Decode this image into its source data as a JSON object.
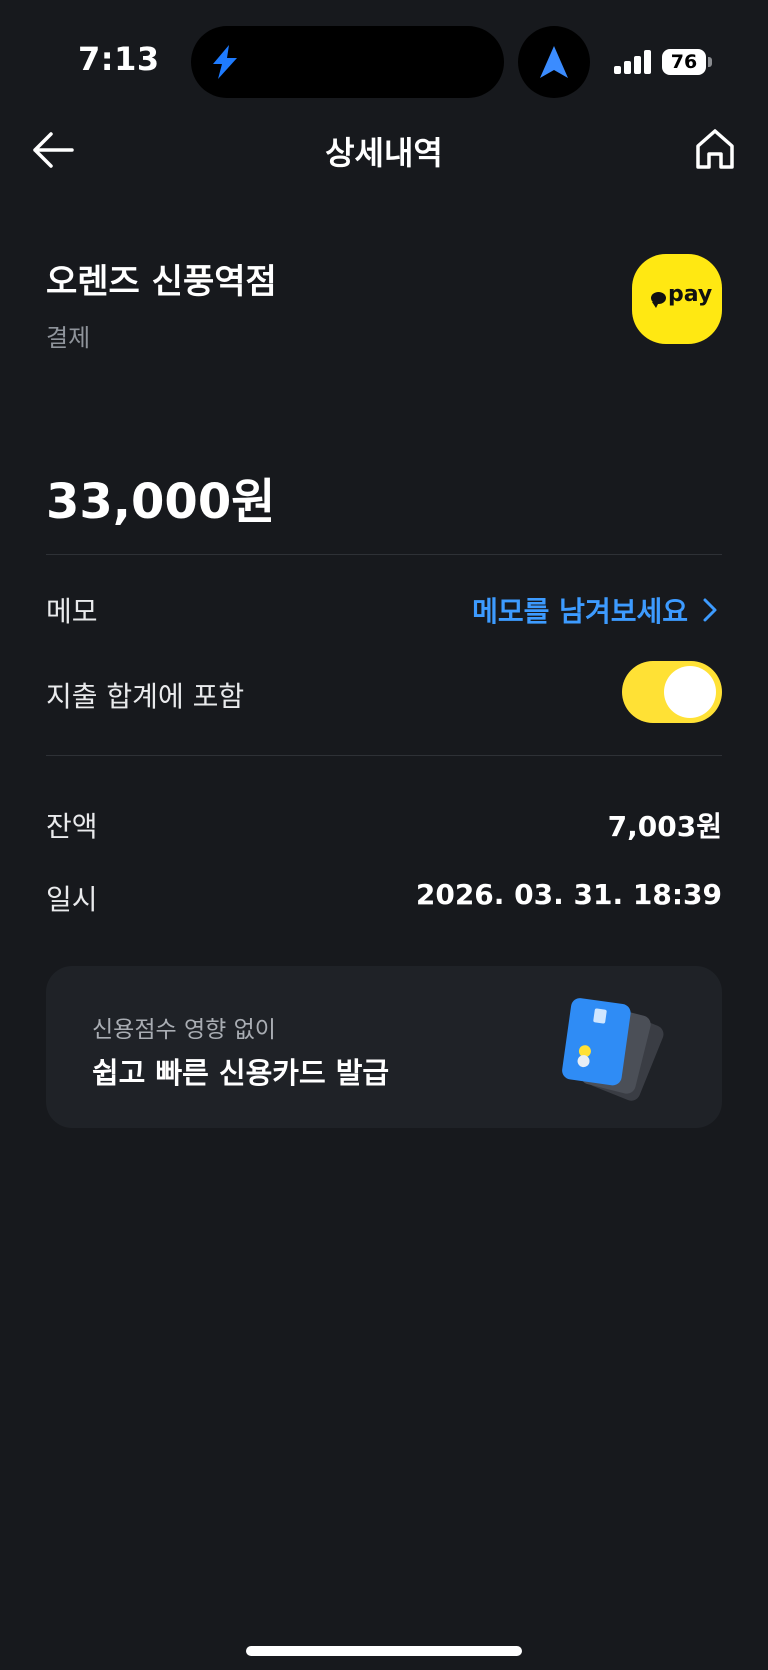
{
  "status_bar": {
    "time": "7:13",
    "battery": "76",
    "island_icon": "app-logo-icon",
    "location_icon": "navigation-arrow-icon"
  },
  "header": {
    "title": "상세내역",
    "back_icon": "arrow-left-icon",
    "home_icon": "home-icon"
  },
  "transaction": {
    "merchant": "오렌즈 신풍역점",
    "type": "결제",
    "payment_badge": "pay",
    "amount": "33,000원"
  },
  "memo": {
    "label": "메모",
    "link": "메모를 남겨보세요"
  },
  "include_total": {
    "label": "지출 합계에 포함",
    "enabled": true
  },
  "details": [
    {
      "label": "잔액",
      "value": "7,003원"
    },
    {
      "label": "일시",
      "value": "2026. 03. 31. 18:39"
    }
  ],
  "promo": {
    "subtitle": "신용점수 영향 없이",
    "title": "쉽고 빠른 신용카드 발급"
  },
  "colors": {
    "background": "#17191d",
    "accent_link": "#3d9bff",
    "kakao_yellow": "#ffe812",
    "toggle_on": "#ffe135"
  }
}
